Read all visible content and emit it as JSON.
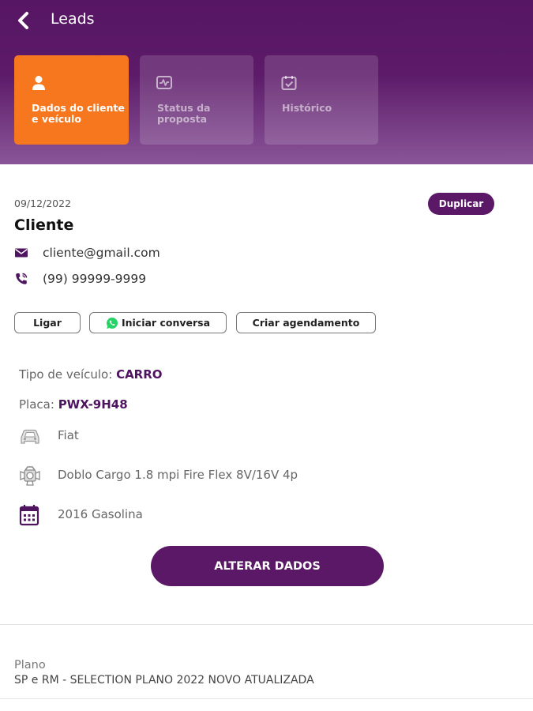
{
  "header": {
    "title": "Leads",
    "back_icon": "chevron-left-icon"
  },
  "tabs": [
    {
      "label": "Dados do cliente\ne veículo",
      "icon": "user-icon",
      "active": true
    },
    {
      "label": "Status da\nproposta",
      "icon": "pulse-chart-icon",
      "active": false
    },
    {
      "label": "Histórico",
      "icon": "calendar-check-icon",
      "active": false
    }
  ],
  "lead": {
    "date": "09/12/2022",
    "duplicate_label": "Duplicar",
    "client_name": "Cliente",
    "email": "cliente@gmail.com",
    "phone": "(99) 99999-9999"
  },
  "actions": {
    "call_label": "Ligar",
    "chat_label": "Iniciar conversa",
    "schedule_label": "Criar agendamento"
  },
  "vehicle": {
    "type_label": "Tipo de veículo:",
    "type_value": "CARRO",
    "plate_label": "Placa:",
    "plate_value": "PWX-9H48",
    "brand": "Fiat",
    "model": "Doblo Cargo 1.8 mpi Fire Flex 8V/16V 4p",
    "year_fuel": "2016 Gasolina"
  },
  "alter_label": "ALTERAR DADOS",
  "plan": {
    "label": "Plano",
    "value": "SP e RM - SELECTION PLANO 2022 NOVO ATUALIZADA"
  },
  "colors": {
    "primary": "#5a1866",
    "header_top": "#571663",
    "header_bottom": "#8a5699",
    "active_tab": "#f7771f",
    "whatsapp": "#25d366"
  }
}
